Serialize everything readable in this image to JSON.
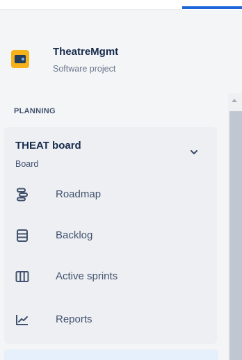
{
  "project": {
    "name": "TheatreMgmt",
    "type": "Software project",
    "avatar_color": "#f6b21b"
  },
  "sidebar": {
    "section_label": "PLANNING",
    "board": {
      "title": "THEAT board",
      "subtitle": "Board",
      "expand_icon": "chevron-down-icon"
    },
    "items": [
      {
        "label": "Roadmap",
        "icon": "roadmap-icon"
      },
      {
        "label": "Backlog",
        "icon": "backlog-icon"
      },
      {
        "label": "Active sprints",
        "icon": "active-sprints-icon"
      },
      {
        "label": "Reports",
        "icon": "reports-icon"
      }
    ]
  },
  "colors": {
    "accent": "#1e66d8",
    "selected_background": "#e6effc",
    "text_primary": "#172b4d",
    "text_secondary": "#42526e"
  }
}
